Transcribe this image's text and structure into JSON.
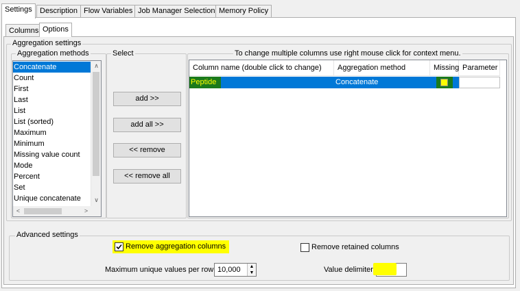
{
  "tabs": [
    "Settings",
    "Description",
    "Flow Variables",
    "Job Manager Selection",
    "Memory Policy"
  ],
  "inner_tabs": [
    "Columns",
    "Options"
  ],
  "aggregation_settings": {
    "title": "Aggregation settings",
    "methods_title": "Aggregation methods",
    "methods": [
      "Concatenate",
      "Count",
      "First",
      "Last",
      "List",
      "List (sorted)",
      "Maximum",
      "Minimum",
      "Missing value count",
      "Mode",
      "Percent",
      "Set",
      "Unique concatenate"
    ],
    "selected_method": "Concatenate",
    "select_title": "Select",
    "buttons": {
      "add": "add >>",
      "add_all": "add all >>",
      "remove": "<< remove",
      "remove_all": "<< remove all"
    },
    "hint": "To change multiple columns use right mouse click for context menu.",
    "table": {
      "headers": [
        "Column name (double click to change)",
        "Aggregation method",
        "Missing",
        "Parameter"
      ],
      "rows": [
        {
          "column": "Peptide",
          "method": "Concatenate",
          "missing": false,
          "parameter": ""
        }
      ]
    }
  },
  "advanced_settings": {
    "title": "Advanced settings",
    "remove_aggregation_columns_label": "Remove aggregation columns",
    "remove_aggregation_columns_checked": true,
    "remove_retained_columns_label": "Remove retained columns",
    "remove_retained_columns_checked": false,
    "max_unique_label": "Maximum unique values per row",
    "max_unique_value": "10,000",
    "value_delimiter_label": "Value delimiter",
    "value_delimiter_value": ""
  },
  "colors": {
    "selection": "#0078d7",
    "highlight_yellow": "#ffff00",
    "highlight_green": "#1b7a1b"
  }
}
